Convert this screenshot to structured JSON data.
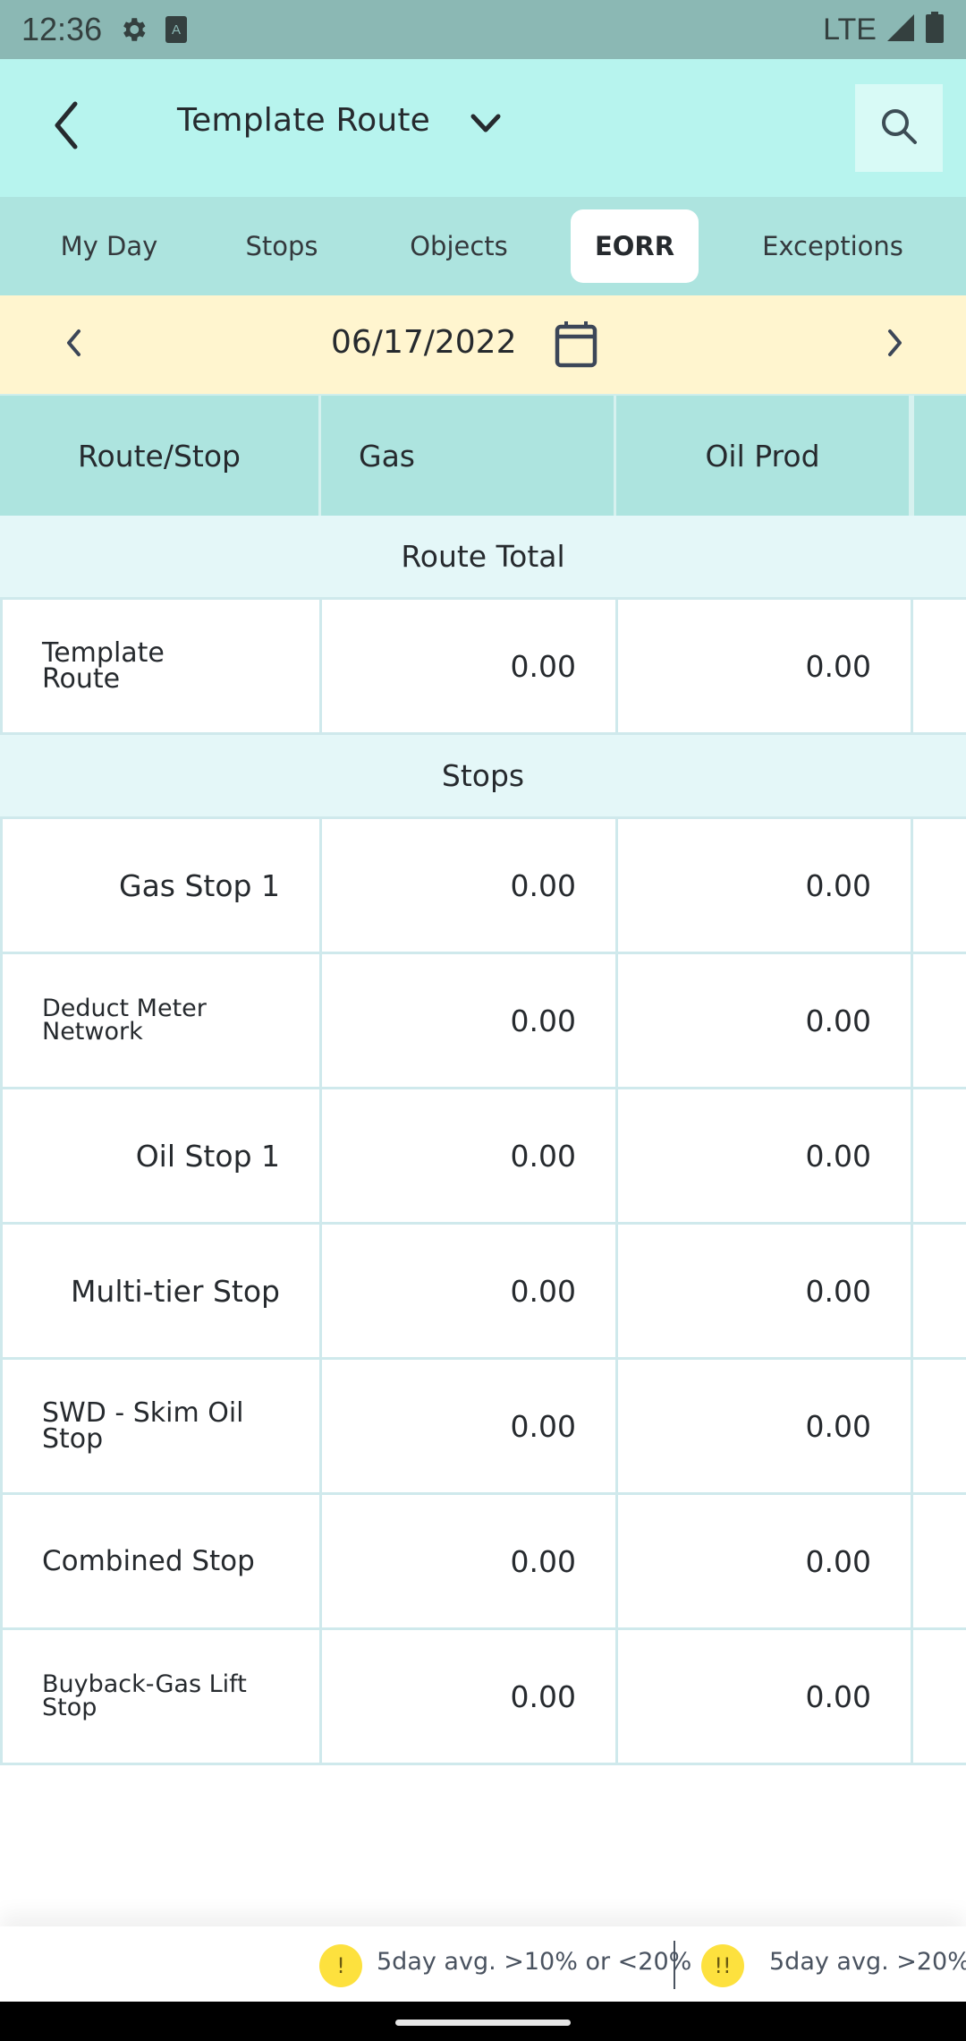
{
  "status_bar": {
    "time": "12:36",
    "icons": [
      "gear-icon",
      "keyboard-a-icon"
    ],
    "network": "LTE",
    "right_icons": [
      "signal-icon",
      "battery-icon"
    ]
  },
  "header": {
    "title": "Template Route",
    "back_icon": "chevron-left-icon",
    "dropdown_icon": "chevron-down-icon",
    "search_icon": "search-icon"
  },
  "tabs": [
    {
      "label": "My Day",
      "active": false
    },
    {
      "label": "Stops",
      "active": false
    },
    {
      "label": "Objects",
      "active": false
    },
    {
      "label": "EORR",
      "active": true
    },
    {
      "label": "Exceptions",
      "active": false
    }
  ],
  "date_bar": {
    "date": "06/17/2022",
    "prev_icon": "chevron-left-icon",
    "next_icon": "chevron-right-icon",
    "calendar_icon": "calendar-icon"
  },
  "table": {
    "columns": [
      "Route/Stop",
      "Gas",
      "Oil Prod"
    ],
    "sections": {
      "route_total": "Route Total",
      "stops": "Stops"
    },
    "route_total_row": {
      "name": "Template Route",
      "gas": "0.00",
      "oil_prod": "0.00"
    },
    "stop_rows": [
      {
        "name": "Gas Stop 1",
        "gas": "0.00",
        "oil_prod": "0.00"
      },
      {
        "name": "Deduct Meter Network",
        "gas": "0.00",
        "oil_prod": "0.00"
      },
      {
        "name": "Oil Stop 1",
        "gas": "0.00",
        "oil_prod": "0.00"
      },
      {
        "name": "Multi-tier Stop",
        "gas": "0.00",
        "oil_prod": "0.00"
      },
      {
        "name": "SWD - Skim Oil Stop",
        "gas": "0.00",
        "oil_prod": "0.00"
      },
      {
        "name": "Combined Stop",
        "gas": "0.00",
        "oil_prod": "0.00"
      },
      {
        "name": "Buyback-Gas Lift Stop",
        "gas": "0.00",
        "oil_prod": "0.00"
      }
    ]
  },
  "legend": [
    {
      "badge": "!",
      "text": "5day avg. >10% or <20%"
    },
    {
      "badge": "!!",
      "text": "5day avg. >20%"
    }
  ],
  "colors": {
    "status_bar": "#8bb8b4",
    "header": "#b7f4ee",
    "tabs_bar": "#ade4df",
    "date_bar": "#fff5cf",
    "section_row": "#e4f7f8",
    "legend_badge": "#fde13e"
  }
}
